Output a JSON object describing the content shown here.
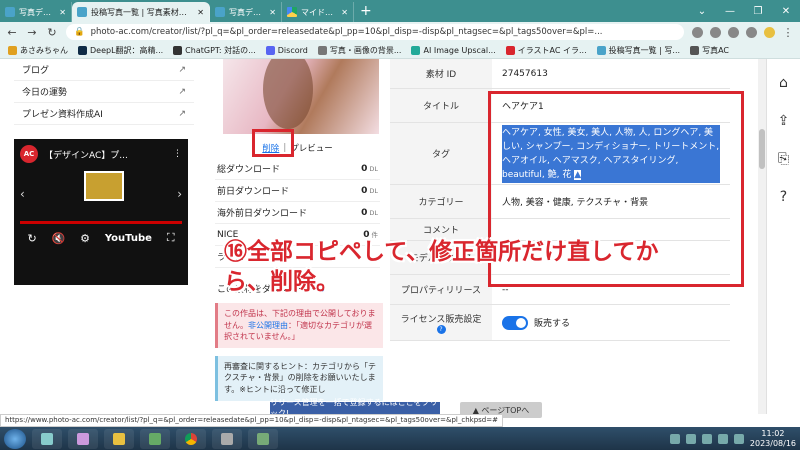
{
  "browser": {
    "tabs": [
      {
        "label": "写真データ編集 | 写真素材ならフ",
        "active": false
      },
      {
        "label": "投稿写真一覧 | 写真素材なら「",
        "active": true
      },
      {
        "label": "写真データ編集 | 写真素材なら",
        "active": false
      },
      {
        "label": "マイドライブ - Google ドライブ",
        "active": false
      }
    ],
    "new_tab": "+",
    "url": "photo-ac.com/creator/list/?pl_q=&pl_order=releasedate&pl_pp=10&pl_disp=-disp&pl_ntagsec=&pl_tags50over=&pl=...",
    "bookmarks": [
      "あさみちゃん",
      "DeepL翻訳：高精...",
      "ChatGPT: 対話の...",
      "Discord",
      "写真・画像の背景...",
      "AI Image Upscal...",
      "イラストAC イラ...",
      "投稿写真一覧 | 写...",
      "写真AC"
    ]
  },
  "sidebar": {
    "items": [
      "ブログ",
      "今日の運勢",
      "プレゼン資料作成AI"
    ],
    "video": {
      "channel": "AC",
      "title": "【デザインAC】プ...",
      "youtube": "YouTube"
    }
  },
  "middle": {
    "delete_link": "削除",
    "separator": "|",
    "preview_link": "プレビュー",
    "stats": [
      {
        "label": "総ダウンロード",
        "value": "0",
        "unit": "DL"
      },
      {
        "label": "前日ダウンロード",
        "value": "0",
        "unit": "DL"
      },
      {
        "label": "海外前日ダウンロード",
        "value": "0",
        "unit": "DL"
      },
      {
        "label": "NICE",
        "value": "0",
        "unit": "件"
      },
      {
        "label": "ライ...",
        "value": "",
        "unit": ""
      }
    ],
    "download_anchor": "この素材をダウンロード",
    "download_arrow": "▼",
    "notice_text": "この作品は、下記の理由で公開しておりません。",
    "notice_link": "非公開理由",
    "notice_rest": "：「適切なカテゴリが選択されていません。」",
    "hint_text": "再審査に関するヒント：カテゴリから「テクスチャ・背景」の削除をお願いいたします。※ヒントに沿って修正し"
  },
  "detail": {
    "rows": [
      {
        "key": "素材 ID",
        "value": "27457613"
      },
      {
        "key": "タイトル",
        "value": "ヘアケア1"
      },
      {
        "key": "タグ",
        "value": "ヘアケア, 女性, 美女, 美人, 人物, 人, ロングヘア, 美しい, シャンプー, コンディショナー, トリートメント, ヘアオイル, ヘアマスク, ヘアスタイリング, beautiful, 艶, 花"
      },
      {
        "key": "カテゴリー",
        "value": "人物, 美容・健康, テクスチャ・背景"
      },
      {
        "key": "コメント",
        "value": ""
      },
      {
        "key": "モデルリリース",
        "value": ""
      },
      {
        "key": "プロパティリリース",
        "value": "--"
      },
      {
        "key": "ライセンス販売設定",
        "value": "販売する"
      }
    ],
    "tag_triangle": "▲"
  },
  "overlay_text": "⑯全部コピペして、修正箇所だけ直してから、削除。",
  "statusbar": {
    "url": "https://www.photo-ac.com/creator/list/?pl_q=&pl_order=releasedate&pl_pp=10&pl_disp=-disp&pl_ntagsec=&pl_tags50over=&pl_chkpsd=#",
    "banner": "リリース管理を一括で登録するにはここをクリック!",
    "pagetop": "▲ ページTOPへ"
  },
  "taskbar": {
    "time": "11:02",
    "date": "2023/08/16"
  },
  "colors": {
    "tab_strip": "#3d8f8f",
    "highlight": "#3a76d4",
    "annotation_red": "#d9262e"
  }
}
